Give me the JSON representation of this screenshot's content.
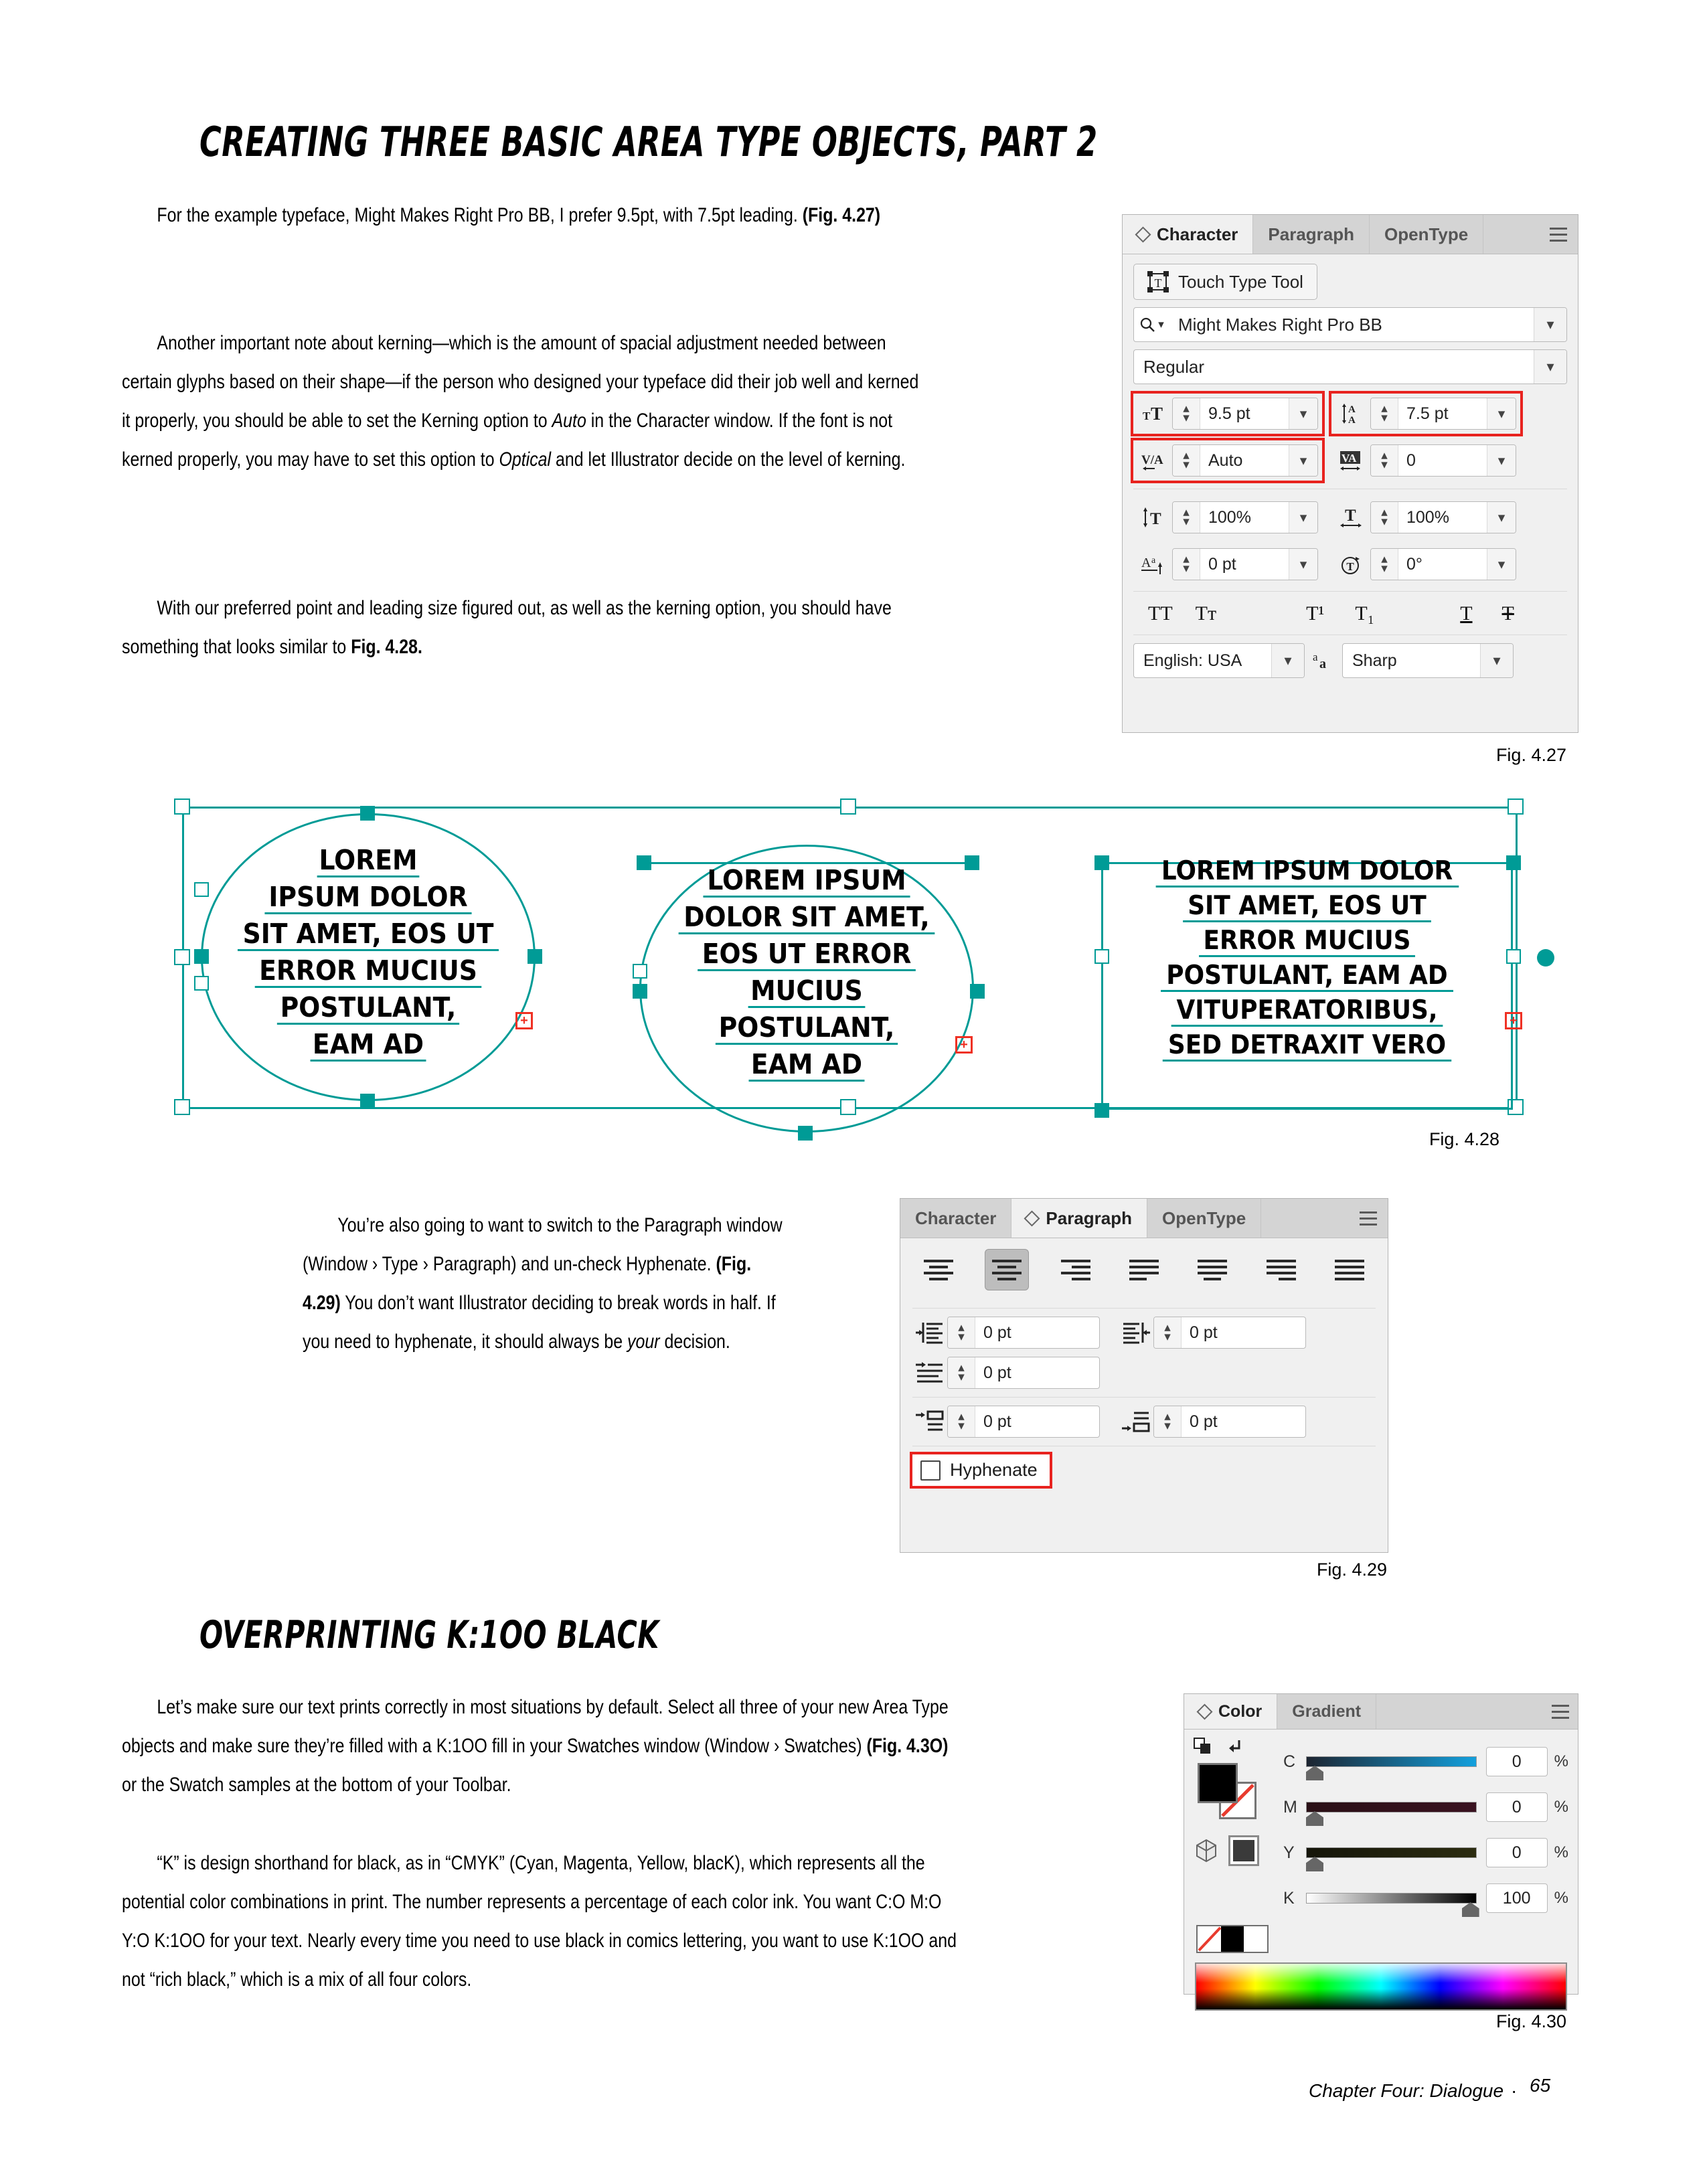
{
  "page": {
    "heading_1": "CREATING THREE BASIC AREA TYPE OBJECTS, PART 2",
    "heading_2": "OVERPRINTING K:1OO BLACK",
    "footer_chapter": "Chapter Four: Dialogue",
    "footer_dot": "·",
    "footer_page": "65"
  },
  "paragraphs": {
    "p1_a": "For the example typeface, Might Makes Right Pro BB, I prefer 9.5pt, with 7.5pt leading. ",
    "p1_b": "(Fig. 4.27)",
    "p2_a": "Another important note about kerning—which is the amount of spacial adjustment needed between certain glyphs based on their shape—if the person who designed your typeface did their job well and kerned it properly, you should be able to set the Kerning option to ",
    "p2_i1": "Auto",
    "p2_b": " in the Character window. If the font is not kerned properly, you may have to set this option to ",
    "p2_i2": "Optical",
    "p2_c": " and let Illustrator decide on the level of kerning.",
    "p3_a": "With our preferred point and leading size figured out, as well as the kerning option, you should have something that looks similar to ",
    "p3_b": "Fig. 4.28.",
    "p4_a": "You’re also going to want to switch to the Paragraph window (Window › Type › Paragraph) and un-check Hyphenate. ",
    "p4_b": "(Fig. 4.29)",
    "p4_c": " You don’t want Illustrator deciding to break words in half. If you need to hyphenate, it should always be ",
    "p4_i": "your",
    "p4_d": " decision.",
    "p5_a": "Let’s make sure our text prints correctly in most situations by default. Select all three of your new Area Type objects and make sure they’re filled with a K:1OO fill in your Swatches window (Window › Swatches) ",
    "p5_b": "(Fig. 4.3O)",
    "p5_c": " or the Swatch samples at the bottom of your Toolbar.",
    "p6": "“K” is design shorthand for black, as in “CMYK” (Cyan, Magenta, Yellow, blacK), which represents all the potential color combinations in print. The number represents a percentage of each color ink. You want C:O M:O Y:O K:1OO for your text. Nearly every time you need to use black in comics lettering, you want to use K:1OO and not “rich black,” which is a mix of all four colors."
  },
  "captions": {
    "fig_427": "Fig. 4.27",
    "fig_428": "Fig. 4.28",
    "fig_429": "Fig. 4.29",
    "fig_430": "Fig. 4.30"
  },
  "character_panel": {
    "tabs": [
      {
        "label": "Character",
        "active": true
      },
      {
        "label": "Paragraph",
        "active": false
      },
      {
        "label": "OpenType",
        "active": false
      }
    ],
    "touch_type_tool": "Touch Type Tool",
    "font_family": "Might Makes Right Pro BB",
    "font_style": "Regular",
    "font_size": "9.5 pt",
    "leading": "7.5 pt",
    "kerning": "Auto",
    "tracking": "0",
    "vertical_scale": "100%",
    "horizontal_scale": "100%",
    "baseline_shift": "0 pt",
    "character_rotation": "0°",
    "language": "English: USA",
    "anti_alias": "Sharp",
    "style_buttons": [
      "TT",
      "Tᴛ",
      "T¹",
      "T₁",
      "T",
      "Ŧ"
    ],
    "highlight_color": "#e8231f"
  },
  "paragraph_panel": {
    "tabs": [
      {
        "label": "Character",
        "active": false
      },
      {
        "label": "Paragraph",
        "active": true
      },
      {
        "label": "OpenType",
        "active": false
      }
    ],
    "alignment_selected_index": 1,
    "alignment_options": [
      "align-left",
      "align-center",
      "align-right",
      "justify-last-left",
      "justify-last-center",
      "justify-last-right",
      "justify-all"
    ],
    "indent_left": "0 pt",
    "indent_right": "0 pt",
    "first_line_indent": "0 pt",
    "space_before": "0 pt",
    "space_after": "0 pt",
    "hyphenate_label": "Hyphenate",
    "hyphenate_checked": false,
    "highlight_color": "#e8231f"
  },
  "color_panel": {
    "tabs": [
      {
        "label": "Color",
        "active": true
      },
      {
        "label": "Gradient",
        "active": false
      }
    ],
    "sliders": [
      {
        "label": "C",
        "value": "0",
        "unit": "%",
        "percent": 0,
        "end_color": "#13a0dd"
      },
      {
        "label": "M",
        "value": "0",
        "unit": "%",
        "percent": 0,
        "end_color": "#ec008c"
      },
      {
        "label": "Y",
        "value": "0",
        "unit": "%",
        "percent": 0,
        "end_color": "#fff200"
      },
      {
        "label": "K",
        "value": "100",
        "unit": "%",
        "percent": 100,
        "end_color": "#000000"
      }
    ],
    "fill_color": "#000000",
    "stroke_color": "none"
  },
  "artboard": {
    "objects": [
      {
        "shape": "ellipse",
        "lines": [
          "LOREM",
          "IPSUM DOLOR",
          "SIT AMET, EOS UT",
          "ERROR MUCIUS",
          "POSTULANT,",
          "EAM AD"
        ],
        "overflow": true
      },
      {
        "shape": "ellipse",
        "lines": [
          "LOREM IPSUM",
          "DOLOR SIT AMET,",
          "EOS UT ERROR",
          "MUCIUS",
          "POSTULANT,",
          "EAM AD"
        ],
        "overflow": true
      },
      {
        "shape": "rectangle",
        "lines": [
          "LOREM IPSUM DOLOR",
          "SIT AMET, EOS UT",
          "ERROR MUCIUS",
          "POSTULANT, EAM AD",
          "VITUPERATORIBUS,",
          "SED DETRAXIT VERO"
        ],
        "overflow": true
      }
    ],
    "selection_color": "#009b96",
    "overflow_color": "#ef3124"
  }
}
